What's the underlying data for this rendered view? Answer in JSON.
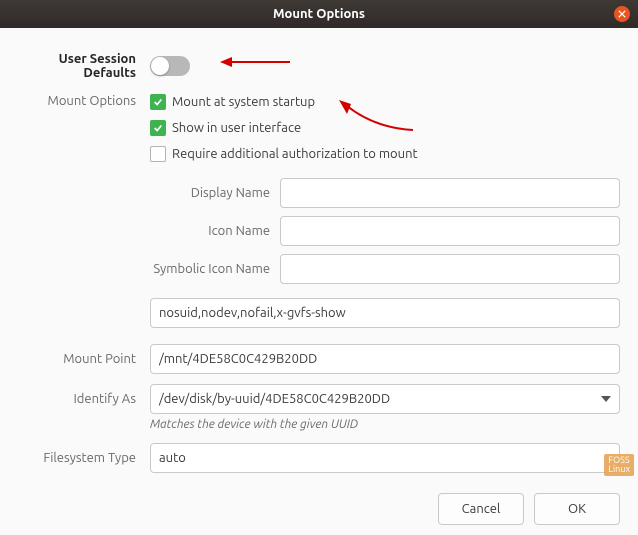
{
  "title": "Mount Options",
  "session_defaults": {
    "label": "User Session Defaults",
    "enabled": false
  },
  "mount_options": {
    "label": "Mount Options",
    "mount_at_startup": {
      "label": "Mount at system startup",
      "checked": true
    },
    "show_in_ui": {
      "label": "Show in user interface",
      "checked": true
    },
    "require_auth": {
      "label": "Require additional authorization to mount",
      "checked": false
    },
    "display_name": {
      "label": "Display Name",
      "value": ""
    },
    "icon_name": {
      "label": "Icon Name",
      "value": ""
    },
    "symbolic_icon_name": {
      "label": "Symbolic Icon Name",
      "value": ""
    },
    "options_string": {
      "value": "nosuid,nodev,nofail,x-gvfs-show"
    }
  },
  "mount_point": {
    "label": "Mount Point",
    "value": "/mnt/4DE58C0C429B20DD"
  },
  "identify_as": {
    "label": "Identify As",
    "value": "/dev/disk/by-uuid/4DE58C0C429B20DD",
    "hint": "Matches the device with the given UUID"
  },
  "filesystem_type": {
    "label": "Filesystem Type",
    "value": "auto"
  },
  "buttons": {
    "cancel": "Cancel",
    "ok": "OK"
  },
  "watermark": "FOSS\nLinux"
}
